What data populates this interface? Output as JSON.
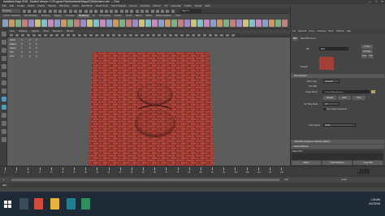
{
  "window": {
    "title": "Autodesk Maya 2018 - Student Version: C:\\Program Files\\Autodesk\\Maya2018\\bin\\demo.mb* --- Rect",
    "win_min": "—",
    "win_max": "□",
    "win_close": "✕"
  },
  "menubar": {
    "items": [
      "File",
      "Edit",
      "Create",
      "Select",
      "Modify",
      "Display",
      "Windows",
      "Mesh",
      "Edit Mesh",
      "Mesh Tools",
      "Mesh Display",
      "Curves",
      "Surfaces",
      "Deform",
      "UV",
      "Generate",
      "Cache",
      "Arnold",
      "Help"
    ],
    "workspace_label": "Workspace:",
    "workspace_value": "Maya Classic"
  },
  "status_line": {
    "mode": "Modeling",
    "sign_in": "Sign In"
  },
  "shelf": {
    "tabs": [
      "Curves / Surfaces",
      "Poly Modeling",
      "Sculpting",
      "Rigging",
      "Animation",
      "Rendering",
      "FX",
      "FX Caching",
      "Custom",
      "Arnold",
      "Bifrost",
      "MASH",
      "Motion Graphics",
      "XGen"
    ],
    "active_tab": "Rendering"
  },
  "viewport": {
    "panel_menu": [
      "View",
      "Shading",
      "Lighting",
      "Show",
      "Renderer",
      "Panels"
    ],
    "camera_label": "persp",
    "hud": {
      "rows": [
        {
          "label": "Verts:",
          "v1": "4",
          "v2": "0",
          "v3": "0"
        },
        {
          "label": "Edges:",
          "v1": "4",
          "v2": "0",
          "v3": "0"
        },
        {
          "label": "Faces:",
          "v1": "1",
          "v2": "0",
          "v3": "0"
        },
        {
          "label": "Tris:",
          "v1": "2",
          "v2": "0",
          "v3": "0"
        },
        {
          "label": "UVs:",
          "v1": "4",
          "v2": "0",
          "v3": "0"
        }
      ]
    },
    "color": "#5c5c5c",
    "brick_color": "#b5443a",
    "mortar_color": "#6a2a26"
  },
  "attribute_editor": {
    "tabs": [
      "List",
      "Selected",
      "Focus",
      "Attributes",
      "Show",
      "TURTLE",
      "Help"
    ],
    "node_tabs": [
      "file1",
      "place2dTexture1"
    ],
    "active_node_tab": "file1",
    "node_label": "file:",
    "node_value": "file1",
    "focus_btn": "Focus",
    "presets_btn": "Presets",
    "show_btn": "Show",
    "hide_btn": "Hide",
    "sample_label": "Sample",
    "section_file_attr": "File Attributes",
    "filter_type_label": "Filter Type",
    "filter_type_value": "Quadratic",
    "prefilter_label": "Pre Filter",
    "image_name_label": "Image Name",
    "image_name_value": "C:/Users/Maya/Brick.jpg",
    "reload_btn": "Reload",
    "edit_btn": "Edit",
    "view_btn": "View",
    "uv_tiling_label": "UV Tiling Mode",
    "uv_tiling_value": "Off",
    "use_image_seq_label": "Use Image Sequence",
    "color_space_label": "Color Space",
    "color_space_value": "sRGB",
    "section_interactive": "Interactive Sequence Caching Options",
    "section_extra": "Extra Attributes",
    "notes_label": "Notes: file1",
    "select_btn": "Select",
    "load_attr_btn": "Load Attributes",
    "copy_tab_btn": "Copy Tab"
  },
  "time_slider": {
    "ticks": [
      "1",
      "5",
      "10",
      "15",
      "20",
      "25",
      "30",
      "35",
      "40",
      "45",
      "50",
      "55",
      "60",
      "65",
      "70",
      "75",
      "80",
      "85",
      "90",
      "95",
      "100",
      "105",
      "110",
      "115",
      "120"
    ],
    "current_frame": "1"
  },
  "range_slider": {
    "start": "1",
    "end": "120",
    "fps": "24 fps"
  },
  "command_line": {
    "mode": "MEL"
  },
  "taskbar": {
    "time": "1:26 AM",
    "date": "3/12/2018"
  }
}
